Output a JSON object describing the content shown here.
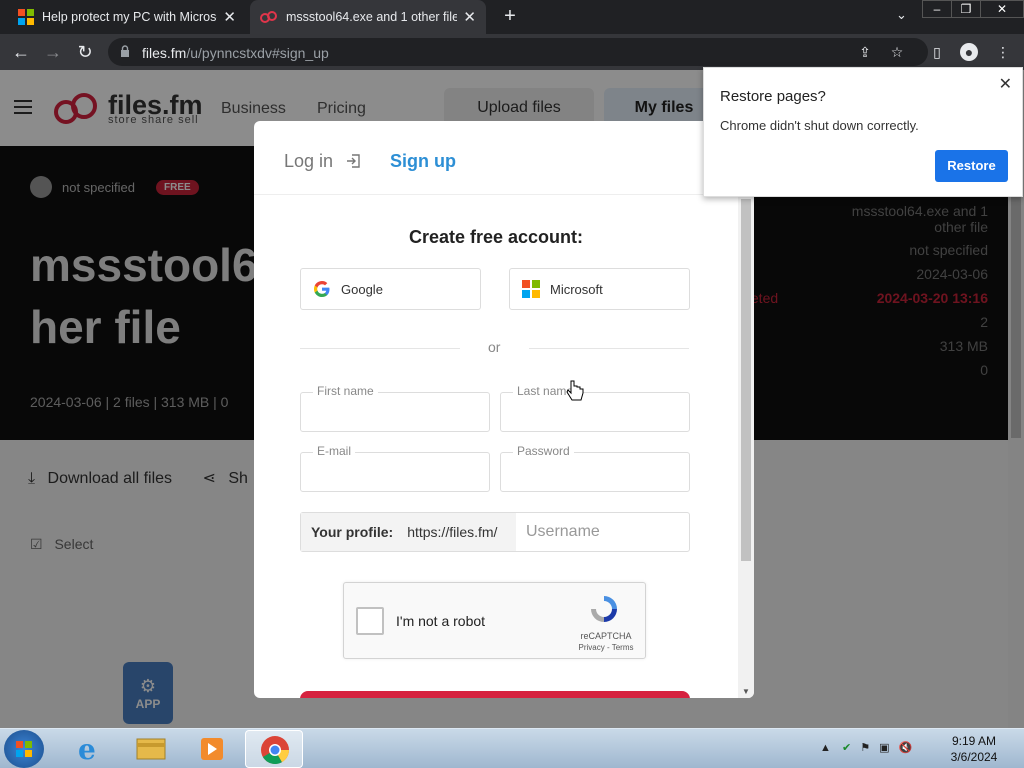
{
  "browser": {
    "tabs": [
      {
        "title": "Help protect my PC with Microso",
        "icon": "windows-logo-icon"
      },
      {
        "title": "mssstool64.exe and 1 other file |",
        "icon": "filesfm-icon"
      }
    ],
    "url_host": "files.fm",
    "url_path": "/u/pynncstxdv#sign_up"
  },
  "site": {
    "logo_text": "files.fm",
    "logo_sub": "store share sell",
    "nav": [
      "Business",
      "Pricing"
    ],
    "upload_btn": "Upload files",
    "myfiles_btn": "My files"
  },
  "hero": {
    "owner": "not specified",
    "badge": "FREE",
    "title_line1": "mssstool6",
    "title_line2": "her file",
    "meta": "2024-03-06 | 2 files | 313 MB | 0"
  },
  "info": {
    "name_line1": "mssstool64.exe and 1",
    "name_line2": "other file",
    "owner": "not specified",
    "uploaded": "2024-03-06",
    "deleted_label": "eleted",
    "deleted": "2024-03-20 13:16",
    "files": "2",
    "size": "313 MB",
    "downloads": "0"
  },
  "actions": {
    "download_all": "Download all files",
    "share": "Sh",
    "select": "Select"
  },
  "app_tile": "APP",
  "modal": {
    "login_tab": "Log in",
    "signup_tab": "Sign up",
    "title": "Create free account:",
    "google": "Google",
    "microsoft": "Microsoft",
    "or": "or",
    "first_name": "First name",
    "last_name": "Last name",
    "email": "E-mail",
    "password": "Password",
    "profile_label": "Your profile:",
    "profile_prefix": "https://files.fm/",
    "username_placeholder": "Username",
    "captcha_label": "I'm not a robot",
    "captcha_brand": "reCAPTCHA",
    "captcha_terms": "Privacy - Terms"
  },
  "restore": {
    "title": "Restore pages?",
    "message": "Chrome didn't shut down correctly.",
    "button": "Restore"
  },
  "taskbar": {
    "time": "9:19 AM",
    "date": "3/6/2024"
  },
  "colors": {
    "accent_blue": "#2d8fd5",
    "brand_red": "#c8243a",
    "chrome_blue": "#1a73e8"
  }
}
